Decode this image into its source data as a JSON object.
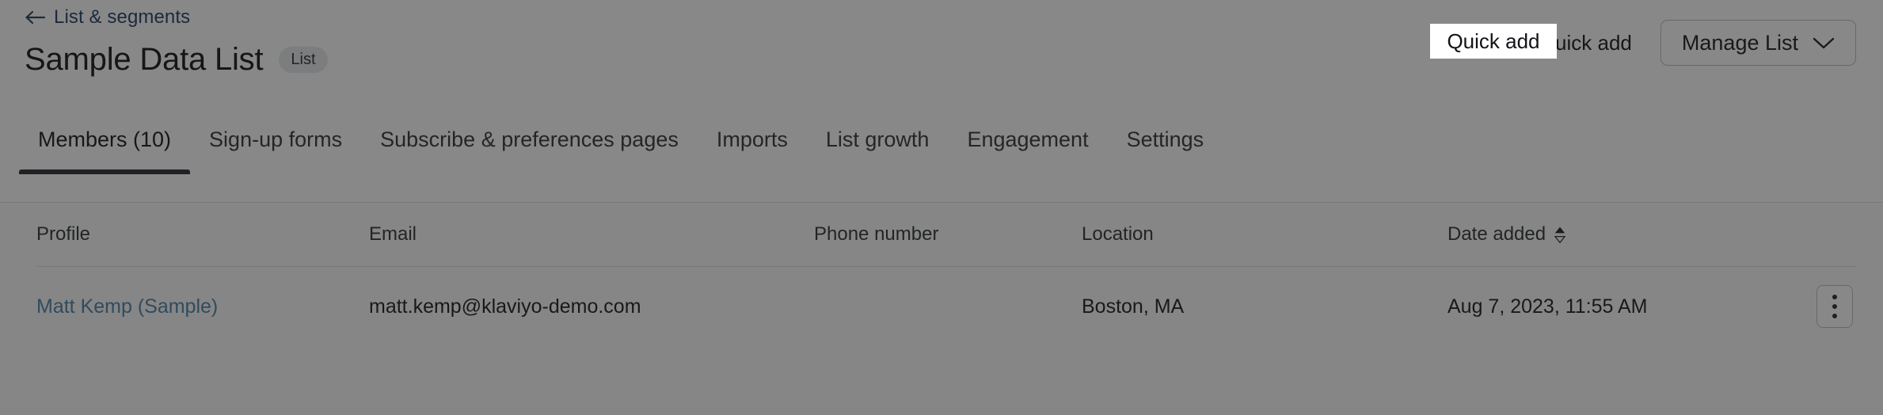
{
  "breadcrumb": {
    "back_label": "List & segments",
    "back_icon": "arrow-left-icon"
  },
  "header": {
    "title": "Sample Data List",
    "badge": "List",
    "quick_add_label": "Quick add",
    "manage_list_label": "Manage List",
    "manage_list_icon": "chevron-down-icon"
  },
  "tabs": [
    {
      "label": "Members (10)",
      "active": true
    },
    {
      "label": "Sign-up forms",
      "active": false
    },
    {
      "label": "Subscribe & preferences pages",
      "active": false
    },
    {
      "label": "Imports",
      "active": false
    },
    {
      "label": "List growth",
      "active": false
    },
    {
      "label": "Engagement",
      "active": false
    },
    {
      "label": "Settings",
      "active": false
    }
  ],
  "table": {
    "columns": [
      {
        "label": "Profile",
        "sortable": false
      },
      {
        "label": "Email",
        "sortable": false
      },
      {
        "label": "Phone number",
        "sortable": false
      },
      {
        "label": "Location",
        "sortable": false
      },
      {
        "label": "Date added",
        "sortable": true,
        "sort_icon": "sort-updown-icon"
      }
    ],
    "rows": [
      {
        "profile": "Matt Kemp (Sample)",
        "email": "matt.kemp@klaviyo-demo.com",
        "phone": "",
        "location": "Boston, MA",
        "date_added": "Aug 7, 2023, 11:55 AM",
        "row_menu_icon": "kebab-menu-icon"
      }
    ]
  },
  "colors": {
    "link": "#1f3b63",
    "profile_link": "#4a7fa6",
    "active_tab_underline": "#26292e",
    "badge_bg": "#e6e8eb",
    "scrim": "rgba(26,26,26,0.52)"
  }
}
